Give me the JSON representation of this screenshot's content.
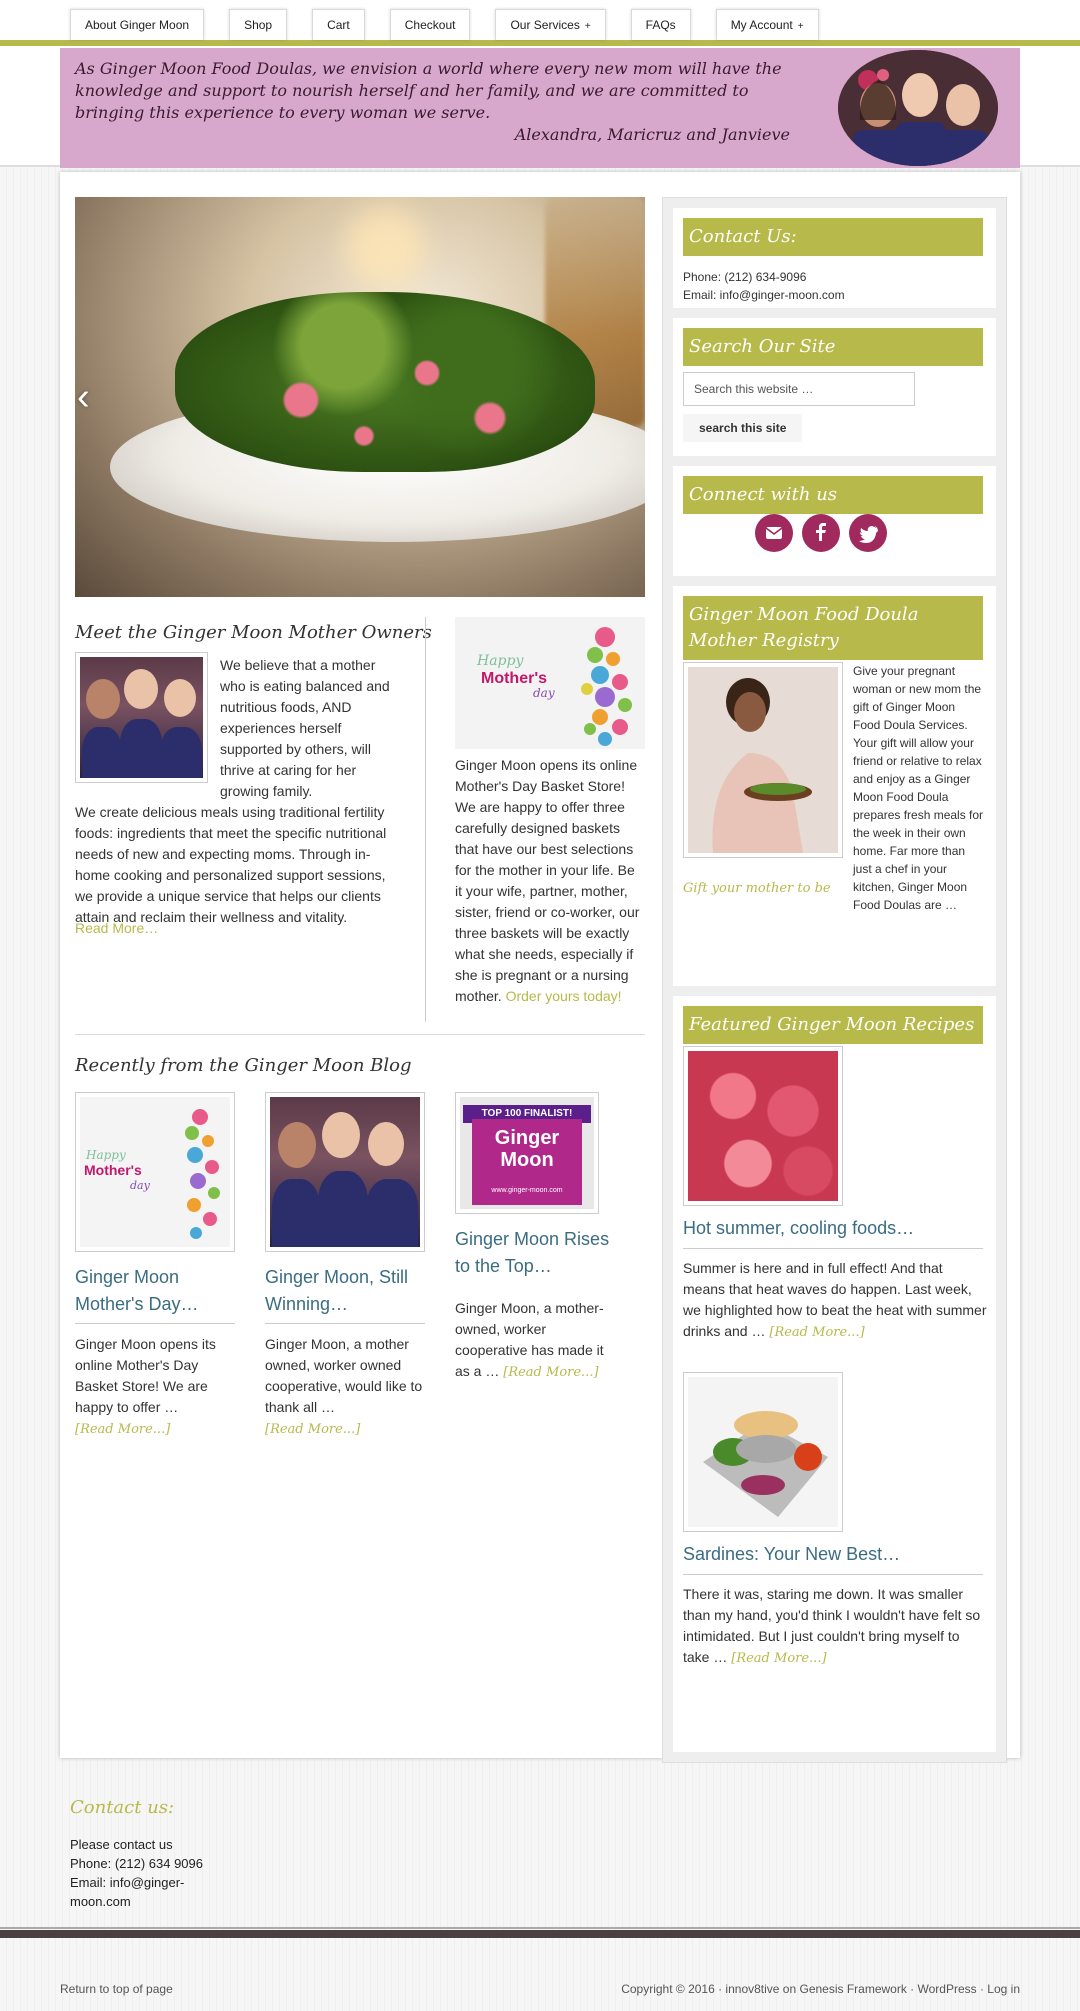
{
  "nav": {
    "items": [
      "About Ginger Moon",
      "Shop",
      "Cart",
      "Checkout",
      "Our Services",
      "FAQs",
      "My Account"
    ],
    "plus": "+"
  },
  "banner": {
    "mission": "As Ginger Moon Food Doulas, we envision a world where every new mom will have the knowledge and support to nourish herself and her  family, and we are committed to bringing this experience to every woman we serve.",
    "signature": "Alexandra, Maricruz and Janvieve"
  },
  "slider": {
    "prev_glyph": "‹"
  },
  "owners": {
    "heading": "Meet the Ginger Moon Mother Owners",
    "para1": "We believe that a mother who is eating balanced and nutritious foods, AND experiences herself supported by others, will thrive at caring for her growing family.",
    "para2": "We create delicious meals using traditional fertility foods: ingredients that meet the specific nutritional needs of new and expecting moms. Through in-home cooking and personalized support sessions, we provide a unique service that helps our clients attain and reclaim their wellness and vitality.",
    "read_more": "Read More…"
  },
  "mothers_day": {
    "img_happy": "Happy",
    "img_mothers": "Mother's",
    "img_day": "day",
    "text": "Ginger Moon opens its online Mother's Day Basket Store! We are happy to offer three carefully designed baskets that have our best selections for the mother in your life. Be it your wife, partner, mother, sister, friend or co-worker, our three baskets will be exactly what she needs, especially if she is pregnant or a nursing mother.",
    "link": "Order yours today!"
  },
  "blog": {
    "heading": "Recently from the Ginger Moon Blog",
    "posts": [
      {
        "title": "Ginger Moon Mother's Day…",
        "excerpt": "Ginger Moon opens its online Mother's Day Basket Store! We are happy to offer …",
        "more": "[Read More...]"
      },
      {
        "title": "Ginger Moon, Still Winning…",
        "excerpt": "Ginger Moon, a mother owned, worker owned cooperative, would like to thank all …",
        "more": "[Read More...]"
      },
      {
        "title": "Ginger Moon Rises to the Top…",
        "excerpt": "  Ginger Moon, a mother-owned, worker cooperative has made it as a …",
        "more": "[Read More...]"
      }
    ],
    "finalist_banner": "TOP 100 FINALIST!",
    "finalist_name": "Ginger Moon",
    "finalist_url": "www.ginger-moon.com"
  },
  "sidebar": {
    "contact": {
      "title": "Contact Us:",
      "phone": "Phone: (212) 634-9096",
      "email": "Email: info@ginger-moon.com"
    },
    "search": {
      "title": "Search Our Site",
      "placeholder": "Search this website …",
      "button": "search this site"
    },
    "connect": {
      "title": "Connect with us",
      "icons": [
        "email-icon",
        "facebook-icon",
        "twitter-icon"
      ]
    },
    "registry": {
      "title": "Ginger Moon Food Doula Mother Registry",
      "text": "Give your pregnant woman or new mom the gift of Ginger Moon Food Doula Services. Your gift will allow your friend or relative to relax and enjoy as a Ginger Moon Food Doula prepares fresh meals for the week in their own home. Far more than just a chef in your kitchen, Ginger Moon Food Doulas are …",
      "link": "Gift your mother to be"
    },
    "recipes": {
      "title": "Featured Ginger Moon Recipes",
      "items": [
        {
          "title": "Hot summer, cooling foods…",
          "excerpt": "Summer is here and in full effect! And that means that heat waves do happen.  Last week, we highlighted how to beat the heat with summer drinks and …",
          "more": "[Read More...]"
        },
        {
          "title": "Sardines: Your New Best…",
          "excerpt": "There it was, staring me down. It was smaller than my hand, you'd think I wouldn't have felt so intimidated. But I just couldn't bring myself to take …",
          "more": "[Read More...]"
        }
      ]
    }
  },
  "footer_widget": {
    "title": "Contact us:",
    "line1": "Please contact us",
    "line2": "Phone: (212) 634 9096",
    "line3": "Email: info@ginger-moon.com"
  },
  "footer": {
    "top_link": "Return to top of page",
    "copyright": "Copyright © 2016 · innov8tive on Genesis Framework · WordPress · Log in"
  },
  "colors": {
    "accent": "#b8b94b",
    "banner": "#d7a8cc",
    "social": "#a0295e",
    "link_blue": "#3a6d82"
  }
}
